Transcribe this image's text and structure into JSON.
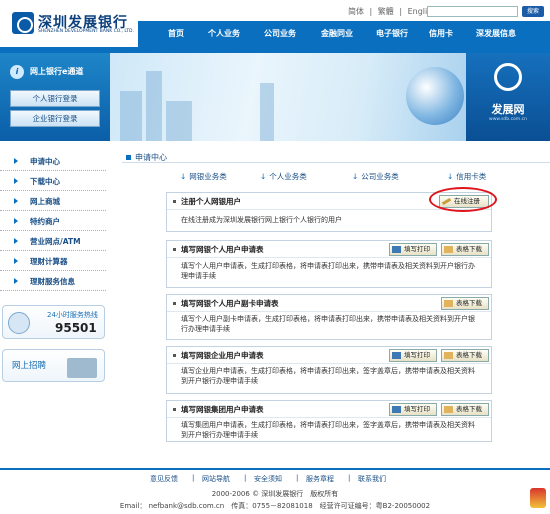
{
  "header": {
    "logo_cn": "深圳发展银行",
    "logo_en": "SHENZHEN DEVELOPMENT BANK CO., LTD.",
    "lang": [
      "简体",
      "|",
      "繁體",
      "|",
      "English"
    ],
    "search_label": "搜索"
  },
  "nav": [
    "首页",
    "个人业务",
    "公司业务",
    "金融同业",
    "电子银行",
    "信用卡",
    "深发展信息"
  ],
  "login": {
    "title": "网上银行e通道",
    "personal": "个人银行登录",
    "corporate": "企业银行登录"
  },
  "right_logo": {
    "name": "发展网",
    "url": "www.sdb.com.cn"
  },
  "side_menu": [
    "申请中心",
    "下载中心",
    "网上商城",
    "特约商户",
    "营业网点/ATM",
    "理财计算器",
    "理财服务信息"
  ],
  "hotline": {
    "title": "24小时服务热线",
    "number": "95501"
  },
  "recruit": {
    "label": "网上招聘"
  },
  "section": {
    "title": "申请中心"
  },
  "tabs": [
    "网银业务类",
    "个人业务类",
    "公司业务类",
    "信用卡类"
  ],
  "cards": [
    {
      "title": "注册个人网银用户",
      "desc": "在线注册成为深圳发展银行网上银行个人银行的用户",
      "btn_register": "在线注册"
    },
    {
      "title": "填写网银个人用户申请表",
      "desc": "填写个人用户申请表，生成打印表格，将申请表打印出来，携带申请表及相关资料到开户银行办理申请手续",
      "btn_print": "填写打印",
      "btn_download": "表格下载"
    },
    {
      "title": "填写网银个人用户副卡申请表",
      "desc": "填写个人用户副卡申请表，生成打印表格，将申请表打印出来，携带申请表及相关资料到开户银行办理申请手续",
      "btn_download": "表格下载"
    },
    {
      "title": "填写网银企业用户申请表",
      "desc": "填写企业用户申请表，生成打印表格，将申请表打印出来，签字盖章后，携带申请表及相关资料到开户银行办理申请手续",
      "btn_print": "填写打印",
      "btn_download": "表格下载"
    },
    {
      "title": "填写网银集团用户申请表",
      "desc": "填写集团用户申请表，生成打印表格，将申请表打印出来，签字盖章后，携带申请表及相关资料到开户银行办理申请手续",
      "btn_print": "填写打印",
      "btn_download": "表格下载"
    }
  ],
  "footer": {
    "links": [
      "意见反馈",
      "|",
      "网站导航",
      "|",
      "安全须知",
      "|",
      "服务章程",
      "|",
      "联系我们"
    ],
    "copyright": "2000-2006 © 深圳发展银行　版权所有",
    "contact": "Email： nefbank@sdb.com.cn　传真：0755－82081018　经营许可证编号：粤B2-20050002"
  },
  "colors": {
    "brand_blue": "#0b6fbf",
    "highlight_red": "#e0141c"
  }
}
